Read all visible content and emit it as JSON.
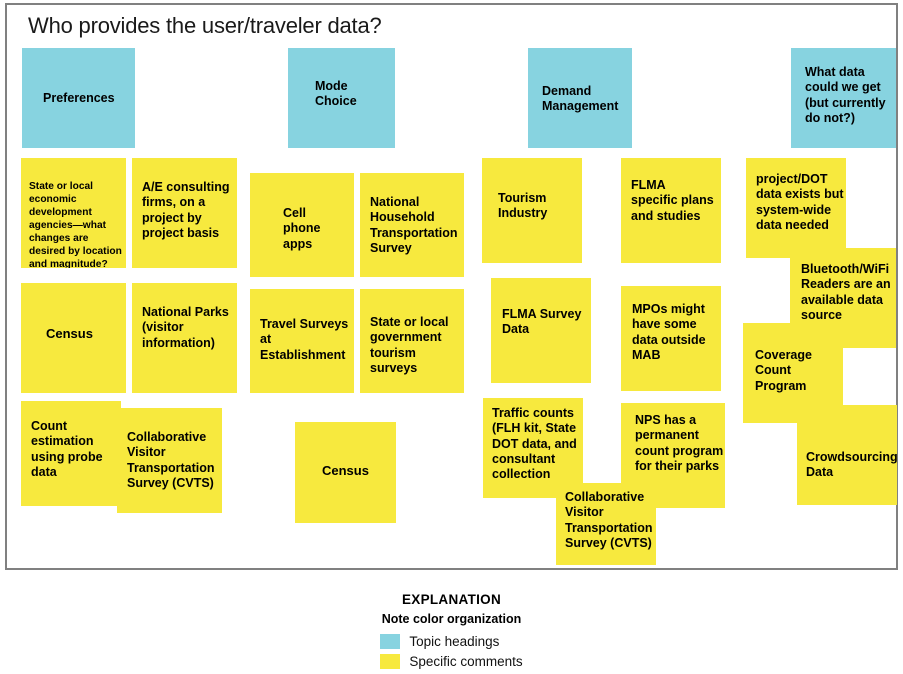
{
  "figure": {
    "title": "Who provides the user/traveler data?",
    "colors": {
      "topic_heading": "#87d3e0",
      "specific_comment": "#f7e93e",
      "border": "#808080",
      "text": "#000000",
      "background": "#ffffff"
    }
  },
  "columns": [
    {
      "id": "preferences",
      "heading": "Preferences",
      "notes": [
        "State or local economic development agencies—what changes are desired by location and magnitude?",
        "A/E consulting firms, on a project by project basis",
        "Census",
        "National Parks (visitor information)",
        "Count estimation using probe data",
        "Collaborative Visitor Transportation Survey (CVTS)"
      ]
    },
    {
      "id": "mode-choice",
      "heading": "Mode Choice",
      "notes": [
        "Cell phone apps",
        "National Household Transportation Survey",
        "Travel Surveys at Establishment",
        "State or local government tourism surveys",
        "Census"
      ]
    },
    {
      "id": "demand-management",
      "heading": "Demand Management",
      "notes": [
        "Tourism Industry",
        "FLMA specific plans and studies",
        "FLMA Survey Data",
        "MPOs might have some data outside MAB",
        "Traffic counts (FLH kit, State DOT data, and consultant collection",
        "NPS has a permanent count program for their parks",
        "Collaborative Visitor Transportation Survey (CVTS)"
      ]
    },
    {
      "id": "what-data-could-we-get",
      "heading": "What data could we get (but currently do not?)",
      "notes": [
        "project/DOT data exists but system-wide data needed",
        "Bluetooth/WiFi Readers are an available data source",
        "Coverage Count Program",
        "Crowdsourcing Data"
      ]
    }
  ],
  "notes": {
    "c1_heading": "Preferences",
    "c1_n1": "State or local economic development agencies—what changes are desired by location and magnitude?",
    "c1_n2": "A/E consulting firms, on a project by project basis",
    "c1_n3": "Census",
    "c1_n4": "National Parks (visitor information)",
    "c1_n5": "Count estimation using probe data",
    "c1_n6": "Collaborative Visitor Transportation Survey (CVTS)",
    "c2_heading": "Mode Choice",
    "c2_n1": "Cell phone apps",
    "c2_n2": "National Household Transportation Survey",
    "c2_n3": "Travel Surveys at Establishment",
    "c2_n4": "State or local government tourism surveys",
    "c2_n5": "Census",
    "c3_heading": "Demand Management",
    "c3_n1": "Tourism Industry",
    "c3_n2": "FLMA specific plans and studies",
    "c3_n3": "FLMA Survey Data",
    "c3_n4": "MPOs might have some data outside MAB",
    "c3_n5": "Traffic counts (FLH kit, State DOT data, and consultant collection",
    "c3_n6": "NPS has a permanent count program for their parks",
    "c3_n7": "Collaborative Visitor Transportation Survey (CVTS)",
    "c4_heading": "What data could we get (but currently do not?)",
    "c4_n1": "project/DOT data exists but system-wide data needed",
    "c4_n2": "Bluetooth/WiFi Readers are an available data source",
    "c4_n3": "Coverage Count Program",
    "c4_n4": "Crowdsourcing Data"
  },
  "legend": {
    "title": "EXPLANATION",
    "subtitle": "Note color organization",
    "items": [
      {
        "color": "#87d3e0",
        "label": "Topic headings"
      },
      {
        "color": "#f7e93e",
        "label": "Specific comments"
      }
    ],
    "item0_label": "Topic headings",
    "item1_label": "Specific comments"
  }
}
